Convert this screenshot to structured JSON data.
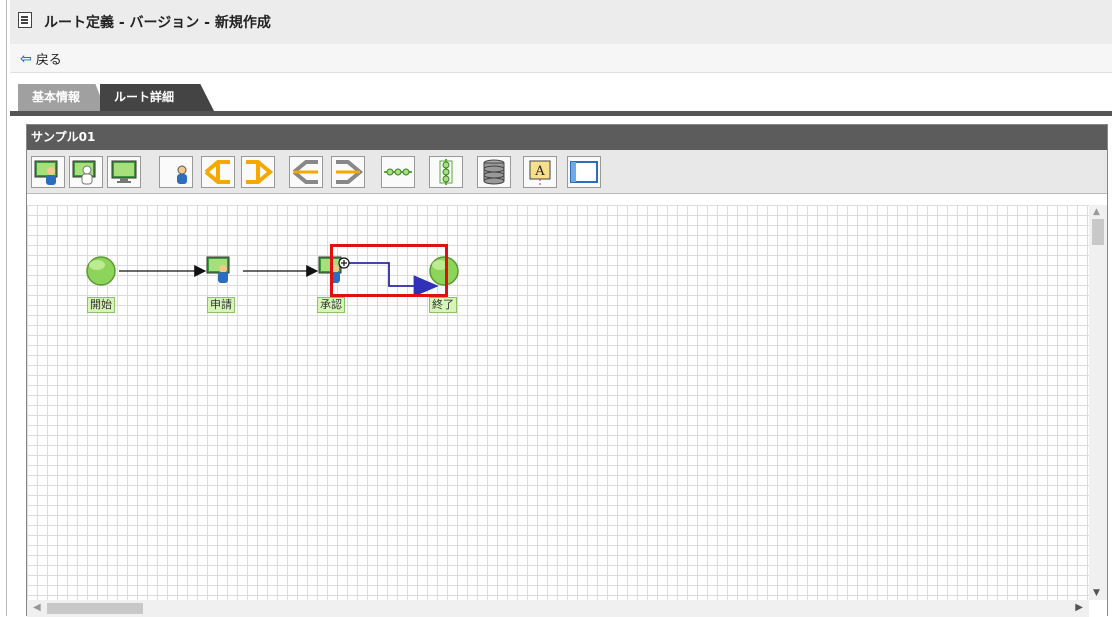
{
  "window": {
    "title": "ルート定義 - バージョン - 新規作成"
  },
  "nav": {
    "back_label": "戻る"
  },
  "tabs": [
    {
      "label": "基本情報",
      "active": false
    },
    {
      "label": "ルート詳細",
      "active": true
    }
  ],
  "route": {
    "name": "サンプル01"
  },
  "toolbar": {
    "tools": [
      {
        "icon": "user-node-icon"
      },
      {
        "icon": "user-node-alt-icon"
      },
      {
        "icon": "screen-node-icon"
      },
      {
        "icon": "person-icon"
      },
      {
        "icon": "split-branch-icon"
      },
      {
        "icon": "join-branch-icon"
      },
      {
        "icon": "split-branch-gray-icon"
      },
      {
        "icon": "join-branch-gray-icon"
      },
      {
        "icon": "sequence-icon"
      },
      {
        "icon": "vertical-sequence-icon"
      },
      {
        "icon": "database-icon"
      },
      {
        "icon": "text-annotation-icon"
      },
      {
        "icon": "window-frame-icon"
      }
    ]
  },
  "diagram": {
    "nodes": [
      {
        "id": "start",
        "label": "開始",
        "type": "start"
      },
      {
        "id": "apply",
        "label": "申請",
        "type": "user"
      },
      {
        "id": "approve",
        "label": "承認",
        "type": "user"
      },
      {
        "id": "end",
        "label": "終了",
        "type": "end"
      }
    ],
    "edges": [
      {
        "from": "start",
        "to": "apply"
      },
      {
        "from": "apply",
        "to": "approve"
      },
      {
        "from": "approve",
        "to": "end",
        "selected": true
      }
    ]
  },
  "colors": {
    "accent": "#2a6fc9",
    "highlight": "#e01010",
    "selected_edge": "#2b2ba8",
    "node_green": "#8cd45a"
  }
}
